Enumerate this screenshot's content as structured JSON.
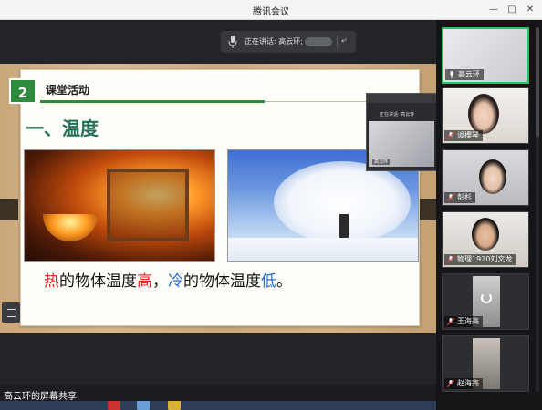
{
  "window": {
    "title": "腾讯会议"
  },
  "speaker": {
    "label": "正在讲话: 高云环;"
  },
  "slide": {
    "number": "2",
    "activity": "课堂活动",
    "heading": "一、温度",
    "caption": {
      "part1": "热",
      "part2": "的物体温度",
      "part3": "高",
      "part4": "，",
      "part5": "冷",
      "part6": "的物体温度",
      "part7": "低",
      "part8": "。"
    }
  },
  "mini_window": {
    "text": "正在讲话: 高云环",
    "name": "高云环"
  },
  "status": {
    "share_label": "高云环的屏幕共享"
  },
  "participants": [
    {
      "name": "高云环",
      "active": true
    },
    {
      "name": "谈櫻琴",
      "active": false
    },
    {
      "name": "彭杉",
      "active": false
    },
    {
      "name": "物理1920刘文龙",
      "active": false
    },
    {
      "name": "王海高",
      "active": false
    },
    {
      "name": "赵海亮",
      "active": false
    }
  ],
  "colors": {
    "accent_green": "#2f8c3c",
    "heading_teal": "#23705a",
    "hot_red": "#e0212a",
    "cold_blue": "#1f6bd6",
    "active_border": "#22c55e"
  },
  "icons": {
    "minimize": "minimize-icon",
    "maximize": "maximize-icon",
    "close": "close-icon",
    "mic": "microphone-icon",
    "share": "share-icon",
    "list": "list-icon"
  }
}
